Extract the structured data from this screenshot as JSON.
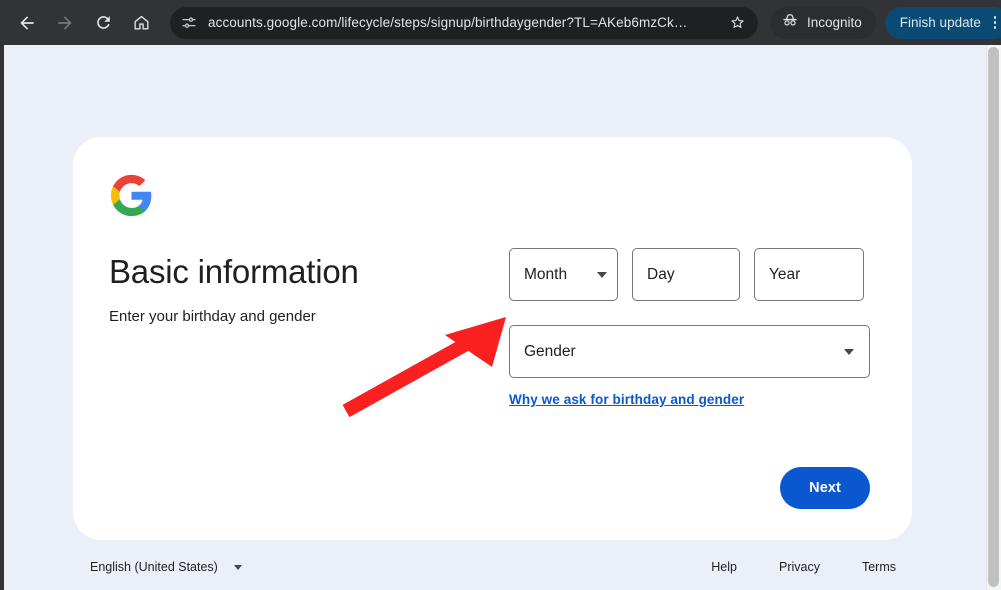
{
  "browser": {
    "nav": {
      "back_label": "Back",
      "forward_label": "Forward",
      "reload_label": "Reload",
      "home_label": "Home"
    },
    "omnibox": {
      "url": "accounts.google.com/lifecycle/steps/signup/birthdaygender?TL=AKeb6mzCk…",
      "site_info_icon": "tune-icon",
      "bookmark_icon": "star-icon"
    },
    "incognito": {
      "label": "Incognito",
      "icon": "incognito-hat-icon"
    },
    "finish_update": {
      "label": "Finish update",
      "menu_icon": "kebab-menu-icon",
      "color": "#0b4a73"
    }
  },
  "page": {
    "logo": "google-logo",
    "title": "Basic information",
    "subtitle": "Enter your birthday and gender",
    "fields": {
      "month": {
        "label": "Month",
        "value": "",
        "placeholder": "Month"
      },
      "day": {
        "label": "Day",
        "value": "",
        "placeholder": "Day"
      },
      "year": {
        "label": "Year",
        "value": "",
        "placeholder": "Year"
      },
      "gender": {
        "label": "Gender",
        "value": "",
        "placeholder": "Gender"
      }
    },
    "why_link": "Why we ask for birthday and gender",
    "next_button": "Next",
    "accent_color": "#0b57d0"
  },
  "footer": {
    "language": "English (United States)",
    "links": [
      {
        "label": "Help"
      },
      {
        "label": "Privacy"
      },
      {
        "label": "Terms"
      }
    ]
  },
  "annotation": {
    "arrow_color": "#fa2020",
    "description": "red-arrow-pointing-to-gender-field"
  }
}
